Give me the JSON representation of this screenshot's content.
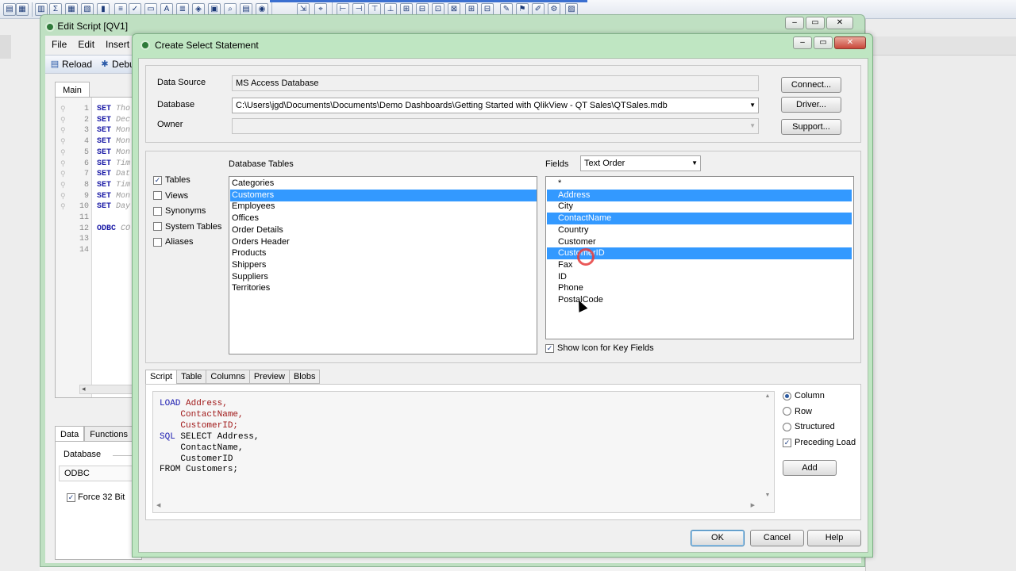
{
  "edit_window": {
    "title": "Edit Script [QV1]",
    "menu": [
      "File",
      "Edit",
      "Insert"
    ],
    "toolbar": {
      "reload": "Reload",
      "debug": "Debug"
    },
    "main_tab": "Main",
    "code_lines": [
      {
        "num": "1",
        "kw": "SET",
        "rest": "Tho"
      },
      {
        "num": "2",
        "kw": "SET",
        "rest": "Dec"
      },
      {
        "num": "3",
        "kw": "SET",
        "rest": "Mon"
      },
      {
        "num": "4",
        "kw": "SET",
        "rest": "Mon"
      },
      {
        "num": "5",
        "kw": "SET",
        "rest": "Mon"
      },
      {
        "num": "6",
        "kw": "SET",
        "rest": "Tim"
      },
      {
        "num": "7",
        "kw": "SET",
        "rest": "Dat"
      },
      {
        "num": "8",
        "kw": "SET",
        "rest": "Tim"
      },
      {
        "num": "9",
        "kw": "SET",
        "rest": "Mon"
      },
      {
        "num": "10",
        "kw": "SET",
        "rest": "Day"
      },
      {
        "num": "11",
        "kw": "",
        "rest": ""
      },
      {
        "num": "12",
        "kw": "ODBC",
        "rest": "CO"
      },
      {
        "num": "13",
        "kw": "",
        "rest": ""
      },
      {
        "num": "14",
        "kw": "",
        "rest": ""
      }
    ],
    "bottom_tabs": [
      "Data",
      "Functions"
    ],
    "database_label": "Database",
    "database_value": "ODBC",
    "force32_label": "Force 32 Bit",
    "force32_checked": "✓"
  },
  "dialog": {
    "title": "Create Select Statement",
    "data_source_label": "Data Source",
    "data_source_value": "MS Access Database",
    "database_label": "Database",
    "database_value": "C:\\Users\\jgd\\Documents\\Documents\\Demo Dashboards\\Getting Started with QlikView - QT Sales\\QTSales.mdb",
    "owner_label": "Owner",
    "owner_value": "",
    "buttons": {
      "connect": "Connect...",
      "driver": "Driver...",
      "support": "Support..."
    },
    "options": [
      {
        "label": "Tables",
        "mark": "✓"
      },
      {
        "label": "Views",
        "mark": ""
      },
      {
        "label": "Synonyms",
        "mark": ""
      },
      {
        "label": "System Tables",
        "mark": ""
      },
      {
        "label": "Aliases",
        "mark": ""
      }
    ],
    "tables_label": "Database Tables",
    "tables": [
      {
        "name": "Categories",
        "selected": false
      },
      {
        "name": "Customers",
        "selected": true
      },
      {
        "name": "Employees",
        "selected": false
      },
      {
        "name": "Offices",
        "selected": false
      },
      {
        "name": "Order Details",
        "selected": false
      },
      {
        "name": "Orders Header",
        "selected": false
      },
      {
        "name": "Products",
        "selected": false
      },
      {
        "name": "Shippers",
        "selected": false
      },
      {
        "name": "Suppliers",
        "selected": false
      },
      {
        "name": "Territories",
        "selected": false
      }
    ],
    "fields_label": "Fields",
    "fields_order": "Text Order",
    "fields": [
      {
        "name": "*",
        "selected": false
      },
      {
        "name": "Address",
        "selected": true
      },
      {
        "name": "City",
        "selected": false
      },
      {
        "name": "ContactName",
        "selected": true
      },
      {
        "name": "Country",
        "selected": false
      },
      {
        "name": "Customer",
        "selected": false
      },
      {
        "name": "CustomerID",
        "selected": true
      },
      {
        "name": "Fax",
        "selected": false
      },
      {
        "name": "ID",
        "selected": false
      },
      {
        "name": "Phone",
        "selected": false
      },
      {
        "name": "PostalCode",
        "selected": false
      }
    ],
    "show_icon_label": "Show Icon for Key Fields",
    "show_icon_checked": "✓",
    "script_tabs": [
      "Script",
      "Table",
      "Columns",
      "Preview",
      "Blobs"
    ],
    "script_lines": [
      {
        "kw": "LOAD",
        "text": " Address,",
        "red": true
      },
      {
        "kw": "",
        "text": "    ContactName,",
        "red": true
      },
      {
        "kw": "",
        "text": "    CustomerID;",
        "red": true
      },
      {
        "kw": "SQL",
        "text": " SELECT Address,",
        "red": false
      },
      {
        "kw": "",
        "text": "    ContactName,",
        "red": false
      },
      {
        "kw": "",
        "text": "    CustomerID",
        "red": false
      },
      {
        "kw": "",
        "text": "FROM Customers;",
        "red": false
      }
    ],
    "layout_options": [
      {
        "label": "Column",
        "on": true
      },
      {
        "label": "Row",
        "on": false
      },
      {
        "label": "Structured",
        "on": false
      }
    ],
    "preceding_load_label": "Preceding Load",
    "preceding_load_checked": "✓",
    "add_button": "Add",
    "ok_button": "OK",
    "cancel_button": "Cancel",
    "help_button": "Help"
  },
  "colors": {
    "selection": "#3399ff",
    "window_frame": "#bfe6c2",
    "keyword": "#1a1ab0",
    "field_red": "#a01818"
  }
}
